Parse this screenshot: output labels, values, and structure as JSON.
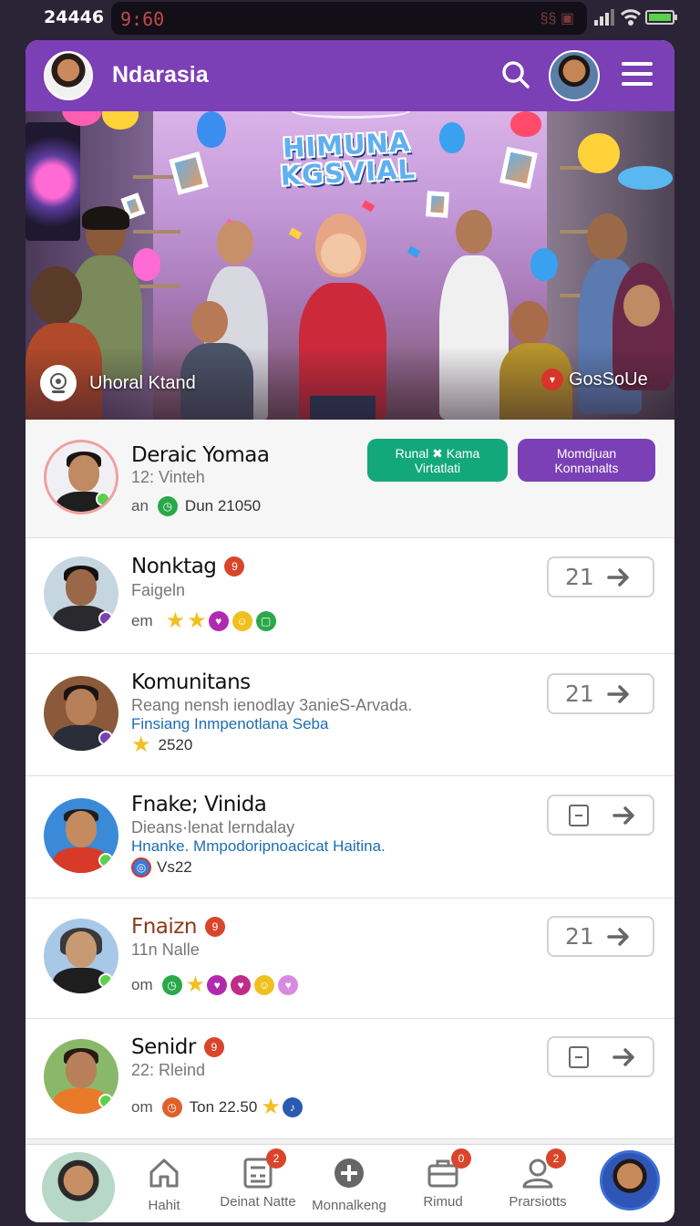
{
  "status_bar": {
    "left_time": "24446",
    "notch_time": "9:60",
    "notch_icons": "§§ ▣"
  },
  "header": {
    "title": "Ndarasia"
  },
  "hero": {
    "banner_line1": "HIMUNA",
    "banner_line2": "KGSVIAL",
    "caption_left": "Uhoral Ktand",
    "caption_right": "GosSoUe"
  },
  "featured": {
    "name": "Deraic Yomaa",
    "subtitle": "12: Vinteh",
    "meta_prefix": "an",
    "meta_value": "Dun 21050",
    "btn_green_line1": "Runal ✖ Kama",
    "btn_green_line2": "Virtatlati",
    "btn_purple_line1": "Momdjuan",
    "btn_purple_line2": "Konnanalts"
  },
  "rows": [
    {
      "name": "Nonktag",
      "badge": "9",
      "subtitle": "Faigeln",
      "meta_prefix": "em",
      "action_value": "21"
    },
    {
      "name": "Komunitans",
      "subtitle": "Reang nensh ienodlay 3anieS-Arvada.",
      "link": "Finsiang Inmpenotlana Seba",
      "meta_value": "2520",
      "action_value": "21"
    },
    {
      "name": "Fnake; Vinida",
      "subtitle": "Dieans·lenat lerndalay",
      "link": "Hnanke. Mmpodoripnoacicat Haitina.",
      "meta_value": "Vs22",
      "action_value": ""
    },
    {
      "name": "Fnaizn",
      "badge": "9",
      "subtitle": "11n Nalle",
      "meta_prefix": "om",
      "action_value": "21"
    },
    {
      "name": "Senidr",
      "badge": "9",
      "subtitle": "22: Rleind",
      "meta_prefix": "om",
      "meta_value": "Ton 22.50",
      "action_value": ""
    }
  ],
  "tabs": [
    {
      "label": "Hahit",
      "icon": "home-icon",
      "badge": ""
    },
    {
      "label": "Deinat Natte",
      "icon": "calculator-icon",
      "badge": "2"
    },
    {
      "label": "Monnalkeng",
      "icon": "add-circle-icon",
      "badge": ""
    },
    {
      "label": "Rimud",
      "icon": "briefcase-icon",
      "badge": "0"
    },
    {
      "label": "Prarsiotts",
      "icon": "person-icon",
      "badge": "2"
    }
  ],
  "colors": {
    "brand_purple": "#7b3fb6",
    "green": "#13a87a",
    "badge_red": "#d9452b",
    "link_blue": "#1c6db3"
  }
}
